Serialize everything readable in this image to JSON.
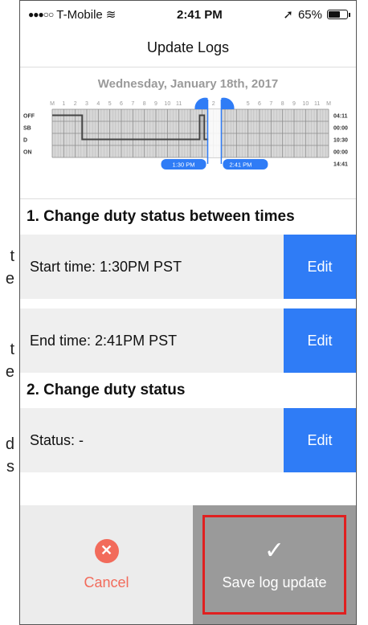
{
  "edge_fragments": [
    "t",
    "e",
    "t",
    "e",
    "d",
    "s"
  ],
  "status_bar": {
    "carrier": "T-Mobile",
    "time": "2:41 PM",
    "battery": "65%",
    "battery_level": 0.65
  },
  "nav": {
    "title": "Update Logs"
  },
  "graph": {
    "date": "Wednesday, January 18th, 2017",
    "hour_labels": [
      "M",
      "1",
      "2",
      "3",
      "4",
      "5",
      "6",
      "7",
      "8",
      "9",
      "10",
      "11",
      "",
      "",
      "2",
      "",
      "",
      "5",
      "6",
      "7",
      "8",
      "9",
      "10",
      "11",
      "M"
    ],
    "rows": [
      "OFF",
      "SB",
      "D",
      "ON"
    ],
    "totals": [
      "04:11",
      "00:00",
      "10:30",
      "00:00",
      "14:41"
    ],
    "selection_start": "1:30 PM",
    "selection_end": "2:41 PM",
    "colors": {
      "grid": "#b9b9b9",
      "grid_dark": "#8d8d8d",
      "line": "#444444",
      "accent": "#2f7cf6"
    }
  },
  "section1": {
    "title": "1. Change duty status between times",
    "start_label": "Start time: 1:30PM PST",
    "end_label": "End time: 2:41PM PST",
    "edit_label": "Edit"
  },
  "section2": {
    "title": "2. Change duty status",
    "status_label": "Status: -",
    "edit_label": "Edit"
  },
  "actions": {
    "cancel_label": "Cancel",
    "save_label": "Save log update",
    "colors": {
      "cancel": "#f26b5b",
      "save_bg": "#9a9a9a",
      "highlight": "#e02020"
    }
  }
}
